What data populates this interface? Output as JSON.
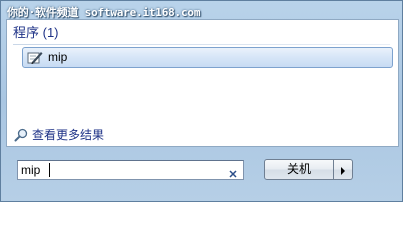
{
  "watermark": {
    "text": "你的·软件频道 software.it168.com"
  },
  "programs": {
    "header": "程序 (1)",
    "items": [
      {
        "label": "mip",
        "icon": "pen-writing-icon"
      }
    ]
  },
  "see_more": {
    "label": "查看更多结果",
    "icon": "magnifier-icon"
  },
  "search": {
    "value": "mip",
    "clear_icon": "clear-x-icon"
  },
  "shutdown": {
    "label": "关机",
    "arrow_icon": "triangle-right-icon"
  },
  "colors": {
    "frame": "#b6cfe6",
    "header_text": "#1e3287",
    "selected_item_border": "#7da2ce",
    "selected_item_fill": "#d6e5f7"
  }
}
